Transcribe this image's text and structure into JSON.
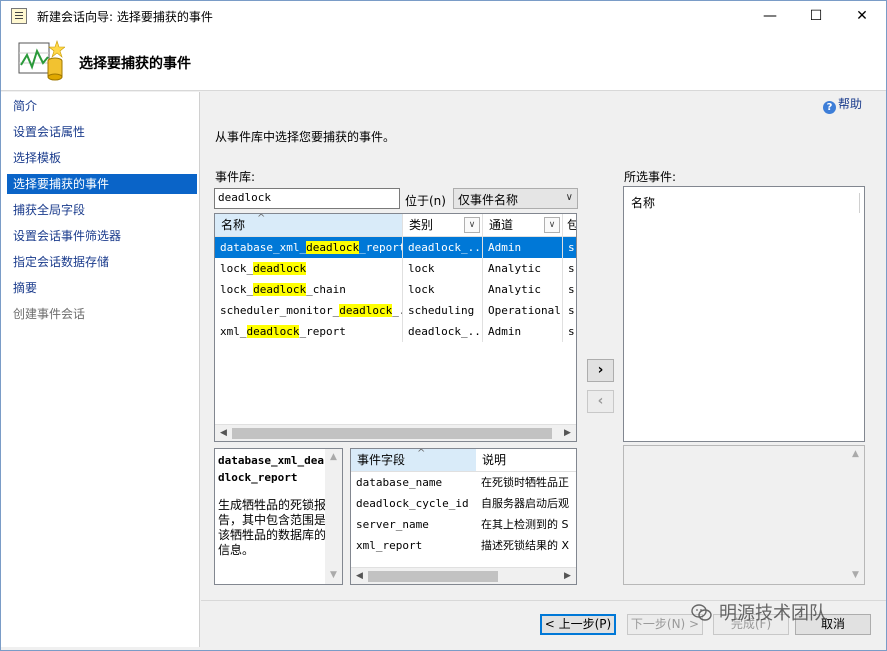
{
  "window": {
    "title": "新建会话向导: 选择要捕获的事件",
    "minimize": "—",
    "maximize": "☐",
    "close": "✕"
  },
  "header": {
    "title": "选择要捕获的事件"
  },
  "sidebar": {
    "items": [
      {
        "label": "简介",
        "state": "link"
      },
      {
        "label": "设置会话属性",
        "state": "link"
      },
      {
        "label": "选择模板",
        "state": "link"
      },
      {
        "label": "选择要捕获的事件",
        "state": "active"
      },
      {
        "label": "捕获全局字段",
        "state": "link"
      },
      {
        "label": "设置会话事件筛选器",
        "state": "link"
      },
      {
        "label": "指定会话数据存储",
        "state": "link"
      },
      {
        "label": "摘要",
        "state": "link"
      },
      {
        "label": "创建事件会话",
        "state": "disabled"
      }
    ]
  },
  "help": {
    "label": "帮助"
  },
  "main": {
    "instruction": "从事件库中选择您要捕获的事件。",
    "library_label": "事件库:",
    "search_value": "deadlock",
    "position_label": "位于(n)",
    "filter_select": "仅事件名称",
    "selected_label": "所选事件:",
    "selected_header": "名称"
  },
  "grid": {
    "columns": [
      "名称",
      "类别",
      "通道",
      "包"
    ],
    "rows": [
      {
        "name": [
          "database_xml_",
          "deadlock",
          "_report"
        ],
        "category": "deadlock_...",
        "channel": "Admin",
        "pkg": "s",
        "selected": true
      },
      {
        "name": [
          "lock_",
          "deadlock",
          ""
        ],
        "category": "lock",
        "channel": "Analytic",
        "pkg": "s",
        "selected": false
      },
      {
        "name": [
          "lock_",
          "deadlock",
          "_chain"
        ],
        "category": "lock",
        "channel": "Analytic",
        "pkg": "s",
        "selected": false
      },
      {
        "name": [
          "scheduler_monitor_",
          "deadlock",
          "_..."
        ],
        "category": "scheduling",
        "channel": "Operational",
        "pkg": "s",
        "selected": false
      },
      {
        "name": [
          "xml_",
          "deadlock",
          "_report"
        ],
        "category": "deadlock_...",
        "channel": "Admin",
        "pkg": "s",
        "selected": false
      }
    ]
  },
  "description": {
    "title": "database_xml_deadlock_report",
    "text": "生成牺牲品的死锁报告，其中包含范围是该牺牲品的数据库的信息。"
  },
  "fields": {
    "columns": [
      "事件字段",
      "说明"
    ],
    "rows": [
      {
        "field": "database_name",
        "desc": "在死锁时牺牲品正"
      },
      {
        "field": "deadlock_cycle_id",
        "desc": "自服务器启动后观"
      },
      {
        "field": "server_name",
        "desc": "在其上检测到的 S"
      },
      {
        "field": "xml_report",
        "desc": "描述死锁结果的 X"
      }
    ]
  },
  "buttons": {
    "add": "›",
    "remove": "‹"
  },
  "footer": {
    "back": "< 上一步(P)",
    "next": "下一步(N) >",
    "finish": "完成(F)",
    "cancel": "取消"
  },
  "watermark": {
    "text": "明源技术团队"
  }
}
